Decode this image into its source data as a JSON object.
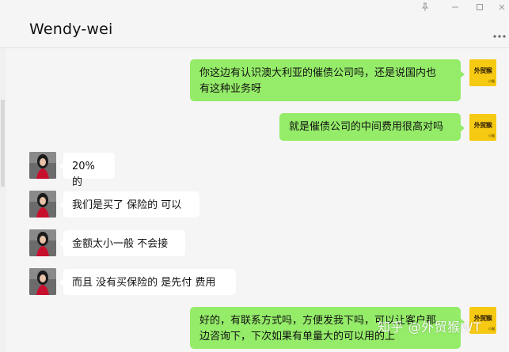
{
  "window": {
    "title": "Wendy-wei",
    "pin_icon": "pin-icon",
    "minimize_icon": "minimize-icon",
    "maximize_icon": "maximize-icon",
    "close_icon": "close-icon",
    "more_icon": "more-icon"
  },
  "messages": [
    {
      "sender": "me",
      "text_lines": [
        "你这边有认识澳大利亚的催债公司吗，还是说国内也",
        "有这种业务呀"
      ]
    },
    {
      "sender": "me",
      "text_lines": [
        "就是催债公司的中间费用很高对吗"
      ]
    },
    {
      "sender": "other",
      "text_lines": [
        "20% 的"
      ]
    },
    {
      "sender": "other",
      "text_lines": [
        "我们是买了 保险的 可以"
      ]
    },
    {
      "sender": "other",
      "text_lines": [
        "金额太小一般 不会接"
      ]
    },
    {
      "sender": "other",
      "text_lines": [
        "而且 没有买保险的 是先付 费用"
      ]
    },
    {
      "sender": "me",
      "text_lines": [
        "好的，有联系方式吗，方便发我下吗，可以让客户那",
        "边咨询下，下次如果有单量大的可以用的上"
      ]
    }
  ],
  "avatars": {
    "me_logo_text": "外贸猴",
    "me_sub_text": "小猴"
  },
  "watermark": "知乎 @外贸猴WT",
  "colors": {
    "my_bubble": "#95ec69",
    "other_bubble": "#ffffff",
    "background": "#f5f5f5",
    "my_avatar": "#f6c913"
  }
}
